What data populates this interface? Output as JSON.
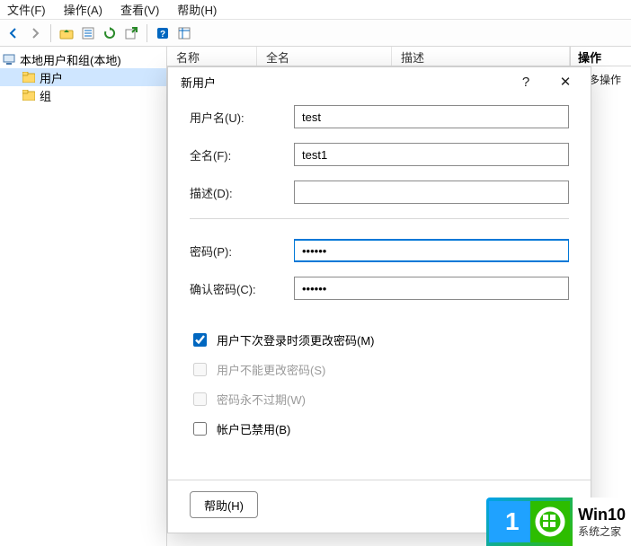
{
  "menu": {
    "file": "文件(F)",
    "action": "操作(A)",
    "view": "查看(V)",
    "help": "帮助(H)"
  },
  "toolbar_icons": {
    "back": "back-icon",
    "fwd": "forward-icon",
    "up": "up-icon",
    "props": "properties-icon",
    "refresh": "refresh-icon",
    "export": "export-icon",
    "help": "help-icon",
    "list": "list-icon"
  },
  "tree": {
    "root": "本地用户和组(本地)",
    "users": "用户",
    "groups": "组"
  },
  "list_columns": {
    "name": "名称",
    "fullname": "全名",
    "description": "描述"
  },
  "right_panel": {
    "header": "操作",
    "more": "更多操作"
  },
  "dialog": {
    "title": "新用户",
    "help_btn": "?",
    "close_btn": "✕",
    "username_label": "用户名(U):",
    "username_value": "test",
    "fullname_label": "全名(F):",
    "fullname_value": "test1",
    "description_label": "描述(D):",
    "description_value": "",
    "password_label": "密码(P):",
    "password_value": "••••••",
    "confirm_label": "确认密码(C):",
    "confirm_value": "••••••",
    "chk_mustchange": "用户下次登录时须更改密码(M)",
    "chk_cannotchange": "用户不能更改密码(S)",
    "chk_neverexpire": "密码永不过期(W)",
    "chk_disabled": "帐户已禁用(B)",
    "footer_help": "帮助(H)"
  },
  "watermark": {
    "badge": "10",
    "line1": "Win10",
    "line2": "系统之家"
  }
}
